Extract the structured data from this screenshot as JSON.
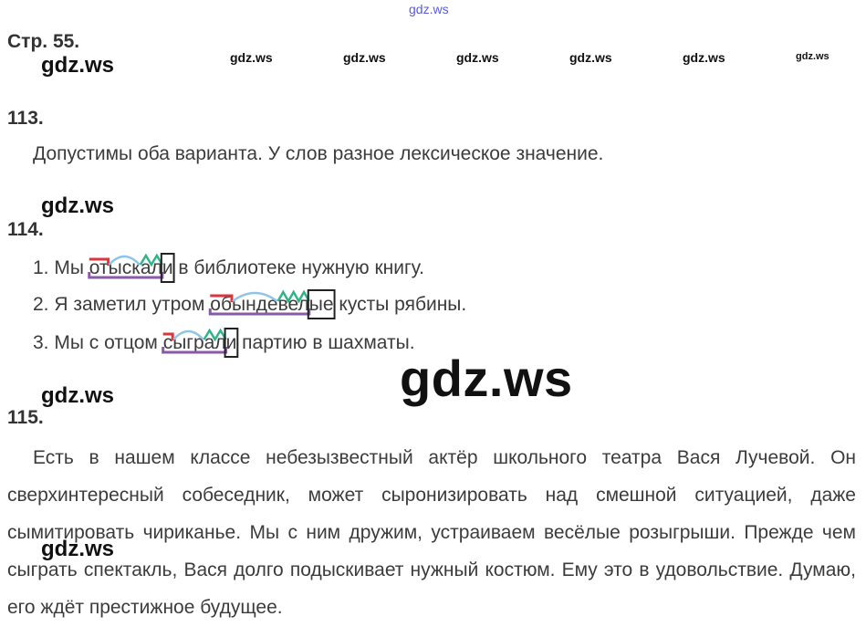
{
  "watermark_top": "gdz.ws",
  "page_ref": "Стр. 55.",
  "watermarks": {
    "small_label": "gdz.ws",
    "big_label": "gdz.ws"
  },
  "ex113": {
    "number": "113.",
    "text": "Допустимы оба варианта. У слов разное лексическое значение."
  },
  "ex114": {
    "number": "114.",
    "sentences": [
      {
        "n": "1. Мы ",
        "prefix": "от",
        "root": "ыск",
        "suffix": "а",
        "suffix2": "л",
        "ending": "и",
        "rest": " в библиотеке нужную книгу."
      },
      {
        "n": "2. Я заметил утром ",
        "prefix": "об",
        "root": "ынде",
        "suffix": "ве",
        "suffix2": "л",
        "ending": "ые",
        "rest": " кусты рябины."
      },
      {
        "n": "3. Мы с отцом ",
        "prefix": "с",
        "root": "ыгр",
        "suffix": "а",
        "suffix2": "л",
        "ending": "и",
        "rest": " партию в шахматы."
      }
    ]
  },
  "ex115": {
    "number": "115.",
    "text": "Есть в нашем классе небезызвестный актёр школьного театра Вася Лучевой. Он сверхинтересный собеседник, может сыронизировать над смешной ситуацией, даже сымитировать чириканье. Мы с ним дружим, устраиваем весёлые розыгрыши. Прежде чем сыграть спектакль, Вася долго подыскивает нужный костюм. Ему это в удовольствие. Думаю, его ждёт престижное будущее."
  },
  "colors": {
    "prefix_mark": "#d9363e",
    "root_mark": "#8fc4e8",
    "suffix_mark": "#2fb489",
    "stem_mark": "#8a5aa8",
    "ending_box": "#222222",
    "watermark_top": "#5b5bd6"
  }
}
